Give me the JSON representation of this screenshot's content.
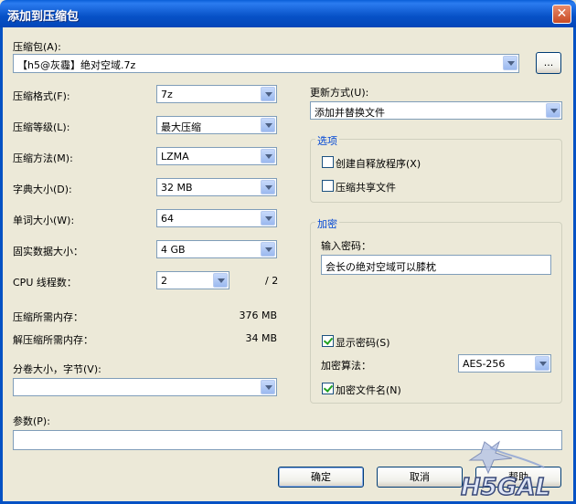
{
  "window": {
    "title": "添加到压缩包",
    "close_glyph": "✕"
  },
  "archive": {
    "label": "压缩包(A):",
    "value": "【h5@灰霾】绝对空域.7z",
    "browse": "..."
  },
  "left_fields": [
    {
      "label": "压缩格式(F):",
      "value": "7z"
    },
    {
      "label": "压缩等级(L):",
      "value": "最大压缩"
    },
    {
      "label": "压缩方法(M):",
      "value": "LZMA"
    },
    {
      "label": "字典大小(D):",
      "value": "32 MB"
    },
    {
      "label": "单词大小(W):",
      "value": "64"
    },
    {
      "label": "固实数据大小：",
      "value": "4 GB"
    }
  ],
  "cpu": {
    "label": "CPU 线程数：",
    "value": "2",
    "total": "/ 2"
  },
  "memory": {
    "compress_label": "压缩所需内存：",
    "compress_value": "376 MB",
    "decompress_label": "解压缩所需内存：",
    "decompress_value": "34 MB"
  },
  "volume": {
    "label": "分卷大小，字节(V):",
    "value": ""
  },
  "params": {
    "label": "参数(P):",
    "value": ""
  },
  "update": {
    "label": "更新方式(U):",
    "value": "添加并替换文件"
  },
  "options": {
    "title": "选项",
    "sfx": {
      "label": "创建自释放程序(X)",
      "checked": false
    },
    "shared": {
      "label": "压缩共享文件",
      "checked": false
    }
  },
  "encryption": {
    "title": "加密",
    "password_label": "输入密码：",
    "password_value": "会长の绝对空域可以膝枕",
    "show_password": {
      "label": "显示密码(S)",
      "checked": true
    },
    "method_label": "加密算法：",
    "method_value": "AES-256",
    "encrypt_names": {
      "label": "加密文件名(N)",
      "checked": true
    }
  },
  "buttons": {
    "ok": "确定",
    "cancel": "取消",
    "help": "帮助"
  },
  "watermark": {
    "text": "H5GAL"
  }
}
